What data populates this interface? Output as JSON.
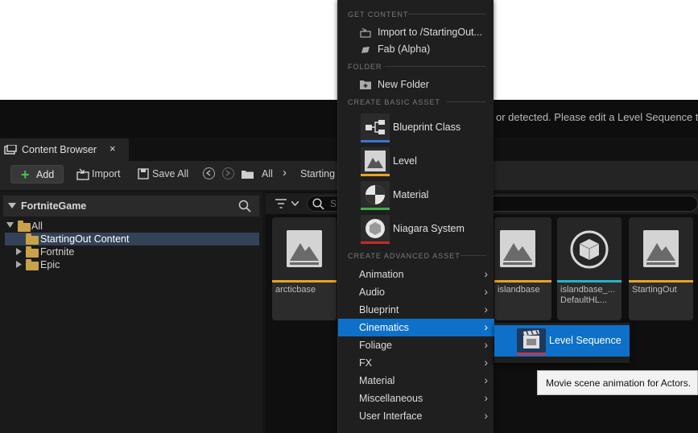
{
  "viewport": {
    "warning_text": "or detected. Please edit a Level Sequence to c"
  },
  "tab": {
    "label": "Content Browser",
    "close": "×"
  },
  "toolbar": {
    "add_label": "Add",
    "import_label": "Import",
    "save_all_label": "Save All",
    "path_all": "All",
    "path_separator": "›",
    "path_current": "Starting"
  },
  "tree": {
    "header": "FortniteGame",
    "items": [
      {
        "label": "All"
      },
      {
        "label": "StartingOut Content"
      },
      {
        "label": "Fortnite"
      },
      {
        "label": "Epic"
      }
    ]
  },
  "filter": {
    "search_placeholder": "S"
  },
  "assets": [
    {
      "name": "arcticbase",
      "bar_color": "#e8a323",
      "icon": "level-icon"
    },
    {
      "name": "islandbase",
      "bar_color": "#e8a323",
      "icon": "level-icon"
    },
    {
      "name": "islandbase_...\nDefaultHL...",
      "bar_color": "#22b5c8",
      "icon": "sphere-icon"
    },
    {
      "name": "StartingOut",
      "bar_color": "#e8a323",
      "icon": "level-icon"
    }
  ],
  "menu": {
    "sections": {
      "get_content": "GET CONTENT",
      "folder": "FOLDER",
      "basic": "CREATE BASIC ASSET",
      "advanced": "CREATE ADVANCED ASSET"
    },
    "import_label": "Import to /StartingOut...",
    "fab_label": "Fab (Alpha)",
    "new_folder_label": "New Folder",
    "basic_assets": [
      {
        "label": "Blueprint Class",
        "color": "#3b74d6"
      },
      {
        "label": "Level",
        "color": "#e8a323"
      },
      {
        "label": "Material",
        "color": "#3fae4a"
      },
      {
        "label": "Niagara System",
        "color": "#c42a2a"
      }
    ],
    "advanced": [
      {
        "label": "Animation"
      },
      {
        "label": "Audio"
      },
      {
        "label": "Blueprint"
      },
      {
        "label": "Cinematics"
      },
      {
        "label": "Foliage"
      },
      {
        "label": "FX"
      },
      {
        "label": "Material"
      },
      {
        "label": "Miscellaneous"
      },
      {
        "label": "User Interface"
      }
    ],
    "chevron": "›"
  },
  "submenu": {
    "item_label": "Level Sequence"
  },
  "tooltip": {
    "text": "Movie scene animation for Actors."
  },
  "colors": {
    "highlight": "#0e70c9",
    "selection": "#344257",
    "folder": "#c9a14a",
    "add_plus": "#46c24a"
  }
}
